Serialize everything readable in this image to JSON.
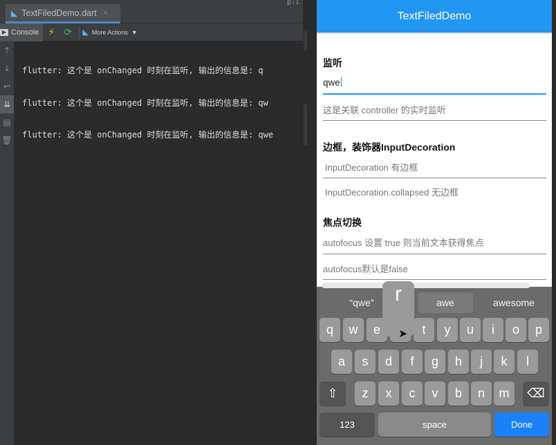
{
  "ide": {
    "tab_label": "TextFiledDemo.dart",
    "tab_close": "×",
    "corner_fragment": "p:i",
    "console_label": "Console",
    "more_actions_label": "More Actions",
    "console_lines": [
      "flutter: 这个是 onChanged 时刻在监听, 输出的信息是: q",
      "flutter: 这个是 onChanged 时刻在监听, 输出的信息是: qw",
      "flutter: 这个是 onChanged 时刻在监听, 输出的信息是: qwe"
    ]
  },
  "app": {
    "title": "TextFiledDemo",
    "accent": "#2196f3",
    "section1_title": "监听",
    "field1_value": "qwe",
    "field2_hint": "这是关联 controller 的实时监听",
    "section2_title": "边框，装饰器InputDecoration",
    "field3_hint": "InputDecoration 有边框",
    "field4_hint": "InputDecoration.collapsed 无边框",
    "section3_title": "焦点切换",
    "field5_hint": "autofocus 设置 true 则当前文本获得焦点",
    "field6_hint": "autofocus默认是false"
  },
  "keyboard": {
    "suggestions": [
      "“qwe”",
      "awe",
      "awesome"
    ],
    "popup_letter": "r",
    "row1": [
      "q",
      "w",
      "e",
      "r",
      "t",
      "y",
      "u",
      "i",
      "o",
      "p"
    ],
    "row2": [
      "a",
      "s",
      "d",
      "f",
      "g",
      "h",
      "j",
      "k",
      "l"
    ],
    "row3": [
      "z",
      "x",
      "c",
      "v",
      "b",
      "n",
      "m"
    ],
    "shift": "⇧",
    "delete": "⌫",
    "numbers_label": "123",
    "space_label": "space",
    "done_label": "Done",
    "done_color": "#1a82fb"
  }
}
